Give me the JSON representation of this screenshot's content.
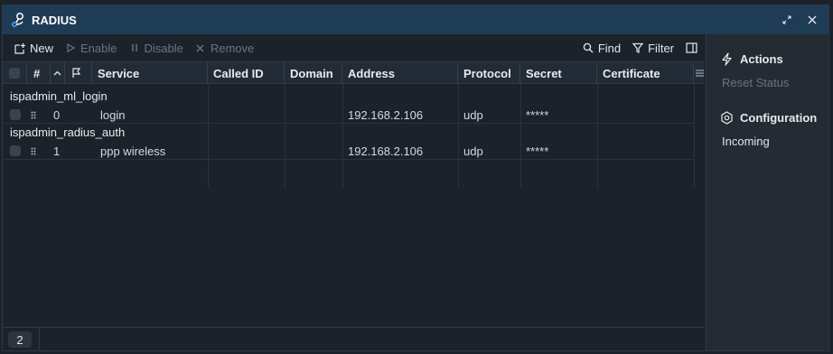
{
  "window": {
    "title": "RADIUS"
  },
  "toolbar": {
    "new_label": "New",
    "enable_label": "Enable",
    "disable_label": "Disable",
    "remove_label": "Remove",
    "find_label": "Find",
    "filter_label": "Filter"
  },
  "table": {
    "columns": [
      "#",
      "Service",
      "Called ID",
      "Domain",
      "Address",
      "Protocol",
      "Secret",
      "Certificate"
    ],
    "groups": [
      {
        "label": "ispadmin_ml_login",
        "row": {
          "index": "0",
          "service": "login",
          "called_id": "",
          "domain": "",
          "address": "192.168.2.106",
          "protocol": "udp",
          "secret": "*****",
          "certificate": ""
        }
      },
      {
        "label": "ispadmin_radius_auth",
        "row": {
          "index": "1",
          "service": "ppp wireless",
          "called_id": "",
          "domain": "",
          "address": "192.168.2.106",
          "protocol": "udp",
          "secret": "*****",
          "certificate": ""
        }
      }
    ]
  },
  "footer": {
    "count": "2"
  },
  "sidebar": {
    "actions_title": "Actions",
    "reset_status": "Reset Status",
    "configuration_title": "Configuration",
    "incoming": "Incoming"
  },
  "colors": {
    "titlebar": "#1f3c57",
    "background": "#1b222a",
    "sidebar": "#242b33",
    "disabled_text": "#6b7580"
  }
}
